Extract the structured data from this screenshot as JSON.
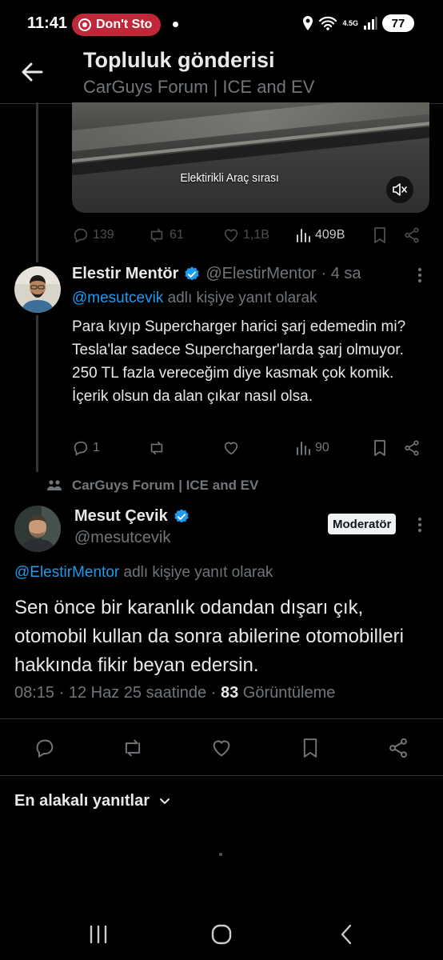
{
  "status_bar": {
    "time": "11:41",
    "recording_pill": "Don't Sto",
    "network": "4.5G",
    "battery": "77"
  },
  "header": {
    "title": "Topluluk gönderisi",
    "subtitle": "CarGuys Forum | ICE and EV"
  },
  "quoted_post": {
    "media_caption": "Elektirikli Araç sırası",
    "replies": "139",
    "reposts": "61",
    "likes": "1,1B",
    "views": "409B"
  },
  "reply_tweet": {
    "display_name": "Elestir Mentör",
    "handle": "@ElestirMentor",
    "time": "· 4 sa",
    "reply_to_handle": "@mesutcevik",
    "reply_to_suffix": " adlı kişiye yanıt olarak",
    "text": "Para kıyıp Supercharger harici şarj edemedin mi? Tesla'lar sadece Supercharger'larda şarj olmuyor. 250 TL fazla vereceğim diye kasmak çok komik. İçerik olsun da alan çıkar nasıl olsa.",
    "replies": "1",
    "views": "90"
  },
  "community": {
    "name": "CarGuys Forum | ICE and EV"
  },
  "main_tweet": {
    "display_name": "Mesut Çevik",
    "handle": "@mesutcevik",
    "badge": "Moderatör",
    "reply_to_handle": "@ElestirMentor",
    "reply_to_suffix": " adlı kişiye yanıt olarak",
    "text": "Sen önce bir karanlık odandan dışarı çık, otomobil kullan da sonra abilerine otomobilleri hakkında fikir beyan edersin.",
    "timestamp": "08:15 · 12 Haz 25 saatinde · ",
    "views_count": "83",
    "views_label": " Görüntüleme"
  },
  "replies_sort": {
    "label": "En alakalı yanıtlar"
  },
  "colors": {
    "background": "#000000",
    "text": "#e7e9ea",
    "muted": "#71767b",
    "accent": "#1d9bf0",
    "recording": "#c0283a"
  }
}
